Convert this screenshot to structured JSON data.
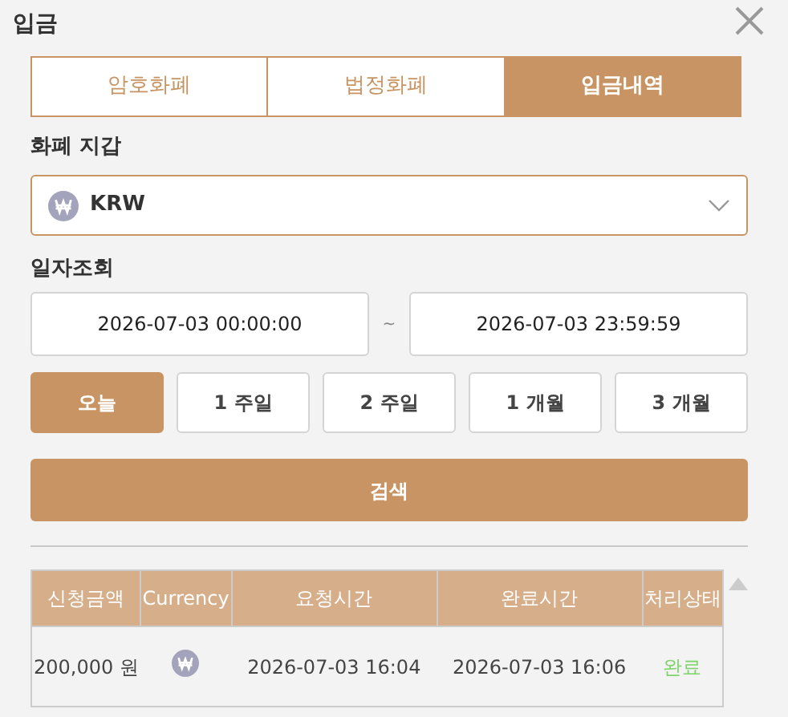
{
  "title": "입금",
  "tabs": [
    {
      "label": "암호화폐",
      "selected": false
    },
    {
      "label": "법정화폐",
      "selected": false
    },
    {
      "label": "입금내역",
      "selected": true
    }
  ],
  "wallet": {
    "label": "화폐 지갑",
    "value": "KRW"
  },
  "date_query": {
    "label": "일자조회",
    "start": "2026-07-03 00:00:00",
    "separator": "~",
    "end": "2026-07-03 23:59:59"
  },
  "periods": [
    {
      "label": "오늘",
      "selected": true
    },
    {
      "label": "1 주일",
      "selected": false
    },
    {
      "label": "2 주일",
      "selected": false
    },
    {
      "label": "1 개월",
      "selected": false
    },
    {
      "label": "3 개월",
      "selected": false
    }
  ],
  "search_button": "검색",
  "table": {
    "columns": [
      "신청금액",
      "Currency",
      "요청시간",
      "완료시간",
      "처리상태"
    ],
    "rows": [
      {
        "amount": "200,000 원",
        "requested": "2026-07-03 16:04",
        "completed": "2026-07-03 16:06",
        "status": "완료"
      }
    ]
  }
}
